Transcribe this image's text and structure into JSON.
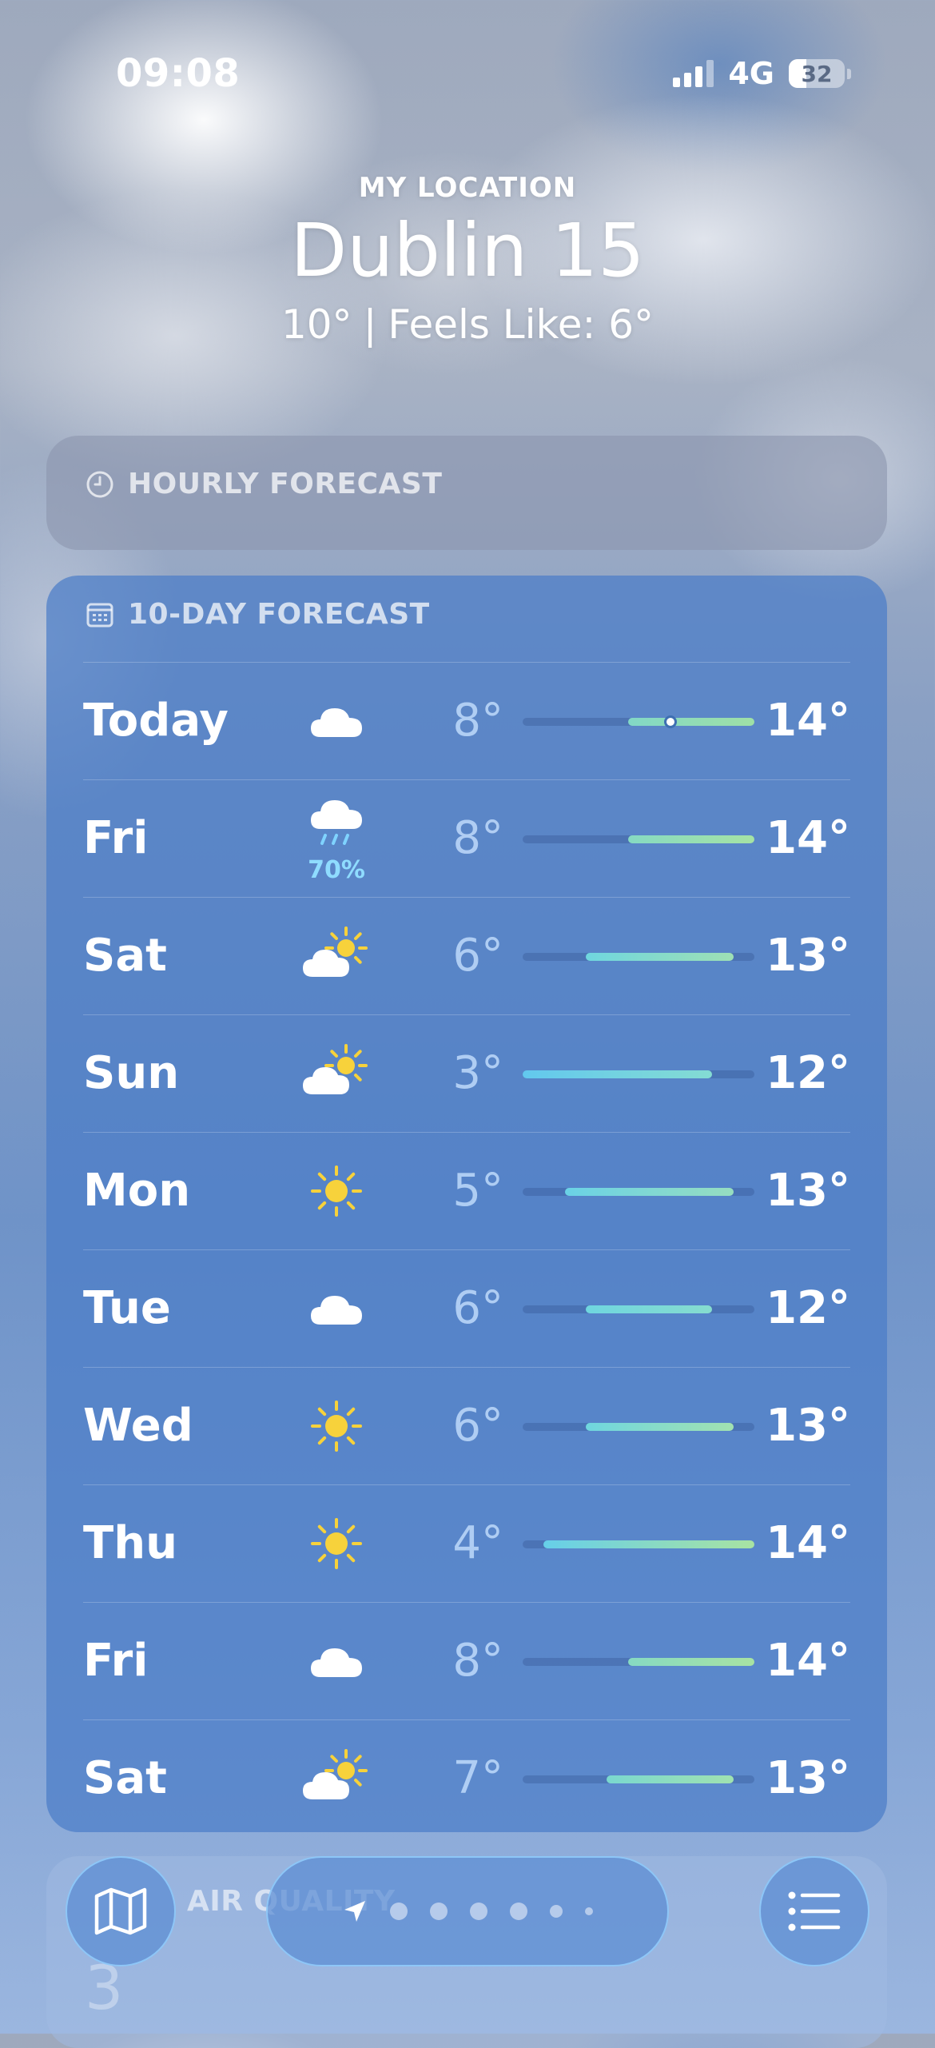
{
  "status_bar": {
    "time": "09:08",
    "network": "4G",
    "battery": "32",
    "battery_level": 0.32
  },
  "header": {
    "location_label": "MY LOCATION",
    "city": "Dublin 15",
    "temperature": "10°",
    "separator": "|",
    "feels_like": "Feels Like: 6°"
  },
  "hourly": {
    "title": "HOURLY FORECAST",
    "icon": "clock-icon"
  },
  "forecast": {
    "title": "10-DAY FORECAST",
    "icon": "calendar-icon",
    "range_min": 3,
    "range_max": 14,
    "days": [
      {
        "day": "Today",
        "icon": "cloud",
        "precip": "",
        "low": "8°",
        "high": "14°",
        "low_value": 8,
        "high_value": 14,
        "current": 10,
        "colors": [
          "#82d8c6",
          "#9fe0a6"
        ]
      },
      {
        "day": "Fri",
        "icon": "cloud-rain",
        "precip": "70%",
        "low": "8°",
        "high": "14°",
        "low_value": 8,
        "high_value": 14,
        "colors": [
          "#86dac2",
          "#a6e3a4"
        ]
      },
      {
        "day": "Sat",
        "icon": "cloud-sun",
        "precip": "",
        "low": "6°",
        "high": "13°",
        "low_value": 6,
        "high_value": 13,
        "colors": [
          "#6fd6df",
          "#9ee0b4"
        ]
      },
      {
        "day": "Sun",
        "icon": "cloud-sun",
        "precip": "",
        "low": "3°",
        "high": "12°",
        "low_value": 3,
        "high_value": 12,
        "colors": [
          "#62c8ee",
          "#84dcd3"
        ]
      },
      {
        "day": "Mon",
        "icon": "sun",
        "precip": "",
        "low": "5°",
        "high": "13°",
        "low_value": 5,
        "high_value": 13,
        "colors": [
          "#6ad2e6",
          "#96ddc0"
        ]
      },
      {
        "day": "Tue",
        "icon": "cloud",
        "precip": "",
        "low": "6°",
        "high": "12°",
        "low_value": 6,
        "high_value": 12,
        "colors": [
          "#6fd6df",
          "#86dccf"
        ]
      },
      {
        "day": "Wed",
        "icon": "sun",
        "precip": "",
        "low": "6°",
        "high": "13°",
        "low_value": 6,
        "high_value": 13,
        "colors": [
          "#6fd6df",
          "#a2e2b0"
        ]
      },
      {
        "day": "Thu",
        "icon": "sun",
        "precip": "",
        "low": "4°",
        "high": "14°",
        "low_value": 4,
        "high_value": 14,
        "colors": [
          "#66cfe9",
          "#a8e3a2"
        ]
      },
      {
        "day": "Fri",
        "icon": "cloud",
        "precip": "",
        "low": "8°",
        "high": "14°",
        "low_value": 8,
        "high_value": 14,
        "colors": [
          "#86dac2",
          "#a8e3a2"
        ]
      },
      {
        "day": "Sat",
        "icon": "cloud-sun",
        "precip": "",
        "low": "7°",
        "high": "13°",
        "low_value": 7,
        "high_value": 13,
        "colors": [
          "#7ad8cf",
          "#a0e2b0"
        ]
      }
    ]
  },
  "air_quality": {
    "title": "AIR QUALITY",
    "value": "3"
  },
  "bottom_bar": {
    "map_icon": "map-icon",
    "location_icon": "location-arrow-icon",
    "list_icon": "list-icon",
    "page_count": 7
  }
}
